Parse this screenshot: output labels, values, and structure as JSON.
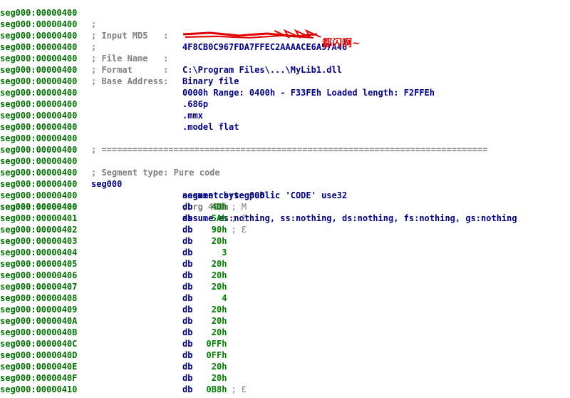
{
  "app": {
    "type": "disassembly listing (IDA style)"
  },
  "colors": {
    "address": "#007000",
    "instruction": "#000080",
    "comment": "#808080",
    "number": "#008000",
    "scribble": "#e00000"
  },
  "header": {
    "seg_addr_0": "seg000:00000400",
    "semicolon_only": ";",
    "md5_label": "; Input MD5   :",
    "md5_value": "4F8CB0C967FDA7FFEC2AAAACE6A97A46",
    "filename_label": "; File Name   :",
    "filename_value_obscured": "C:\\Program Files\\...\\MyLib1.dll",
    "format_label": "; Format      :",
    "format_value": "Binary file",
    "base_label": "; Base Address:",
    "base_value": "0000h Range: 0400h - F33FEh Loaded length: F2FFEh",
    "annotation": "都闪啊~"
  },
  "directives": {
    "cpu": ".686p",
    "mmx": ".mmx",
    "model": ".model flat"
  },
  "separator": "; ===========================================================================",
  "segment": {
    "type_comment": "; Segment type: Pure code",
    "name": "seg000",
    "decl": "segment byte public 'CODE' use32",
    "assume1": "assume cs:seg000",
    "org": ";org 400h",
    "assume2": "assume es:nothing, ss:nothing, ds:nothing, fs:nothing, gs:nothing"
  },
  "db_rows": [
    {
      "addr": "seg000:00000400",
      "mnem": "db",
      "val": "4Dh",
      "cmt": "; M"
    },
    {
      "addr": "seg000:00000401",
      "mnem": "db",
      "val": "5Ah",
      "cmt": "; Z"
    },
    {
      "addr": "seg000:00000402",
      "mnem": "db",
      "val": "90h",
      "cmt": "; Ɛ"
    },
    {
      "addr": "seg000:00000403",
      "mnem": "db",
      "val": "20h",
      "cmt": ""
    },
    {
      "addr": "seg000:00000404",
      "mnem": "db",
      "val": "3",
      "cmt": ""
    },
    {
      "addr": "seg000:00000405",
      "mnem": "db",
      "val": "20h",
      "cmt": ""
    },
    {
      "addr": "seg000:00000406",
      "mnem": "db",
      "val": "20h",
      "cmt": ""
    },
    {
      "addr": "seg000:00000407",
      "mnem": "db",
      "val": "20h",
      "cmt": ""
    },
    {
      "addr": "seg000:00000408",
      "mnem": "db",
      "val": "4",
      "cmt": ""
    },
    {
      "addr": "seg000:00000409",
      "mnem": "db",
      "val": "20h",
      "cmt": ""
    },
    {
      "addr": "seg000:0000040A",
      "mnem": "db",
      "val": "20h",
      "cmt": ""
    },
    {
      "addr": "seg000:0000040B",
      "mnem": "db",
      "val": "20h",
      "cmt": ""
    },
    {
      "addr": "seg000:0000040C",
      "mnem": "db",
      "val": "0FFh",
      "cmt": ""
    },
    {
      "addr": "seg000:0000040D",
      "mnem": "db",
      "val": "0FFh",
      "cmt": ""
    },
    {
      "addr": "seg000:0000040E",
      "mnem": "db",
      "val": "20h",
      "cmt": ""
    },
    {
      "addr": "seg000:0000040F",
      "mnem": "db",
      "val": "20h",
      "cmt": ""
    },
    {
      "addr": "seg000:00000410",
      "mnem": "db",
      "val": "0B8h",
      "cmt": "; Ɛ"
    }
  ]
}
